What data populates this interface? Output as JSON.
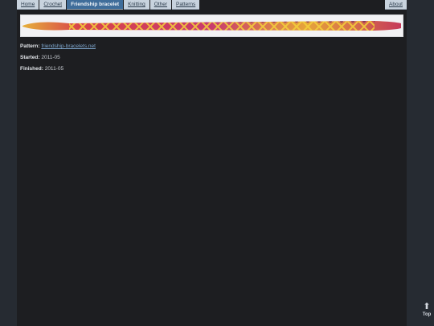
{
  "nav": {
    "items": [
      {
        "label": "Home"
      },
      {
        "label": "Crochet"
      },
      {
        "label": "Friendship bracelet"
      },
      {
        "label": "Knitting"
      },
      {
        "label": "Other"
      },
      {
        "label": "Patterns"
      }
    ],
    "active_index": 2,
    "about": "About"
  },
  "banner": {
    "colors": [
      "#d8324a",
      "#f0c020",
      "#e86a2a",
      "#7a2a5a",
      "#c83aa0"
    ]
  },
  "details": {
    "pattern_label": "Pattern:",
    "pattern_link": "friendship-bracelets.net",
    "started_label": "Started:",
    "started_value": "2011-05",
    "finished_label": "Finished:",
    "finished_value": "2011-05"
  },
  "top_link": {
    "icon": "arrow-up-icon",
    "label": "Top"
  }
}
